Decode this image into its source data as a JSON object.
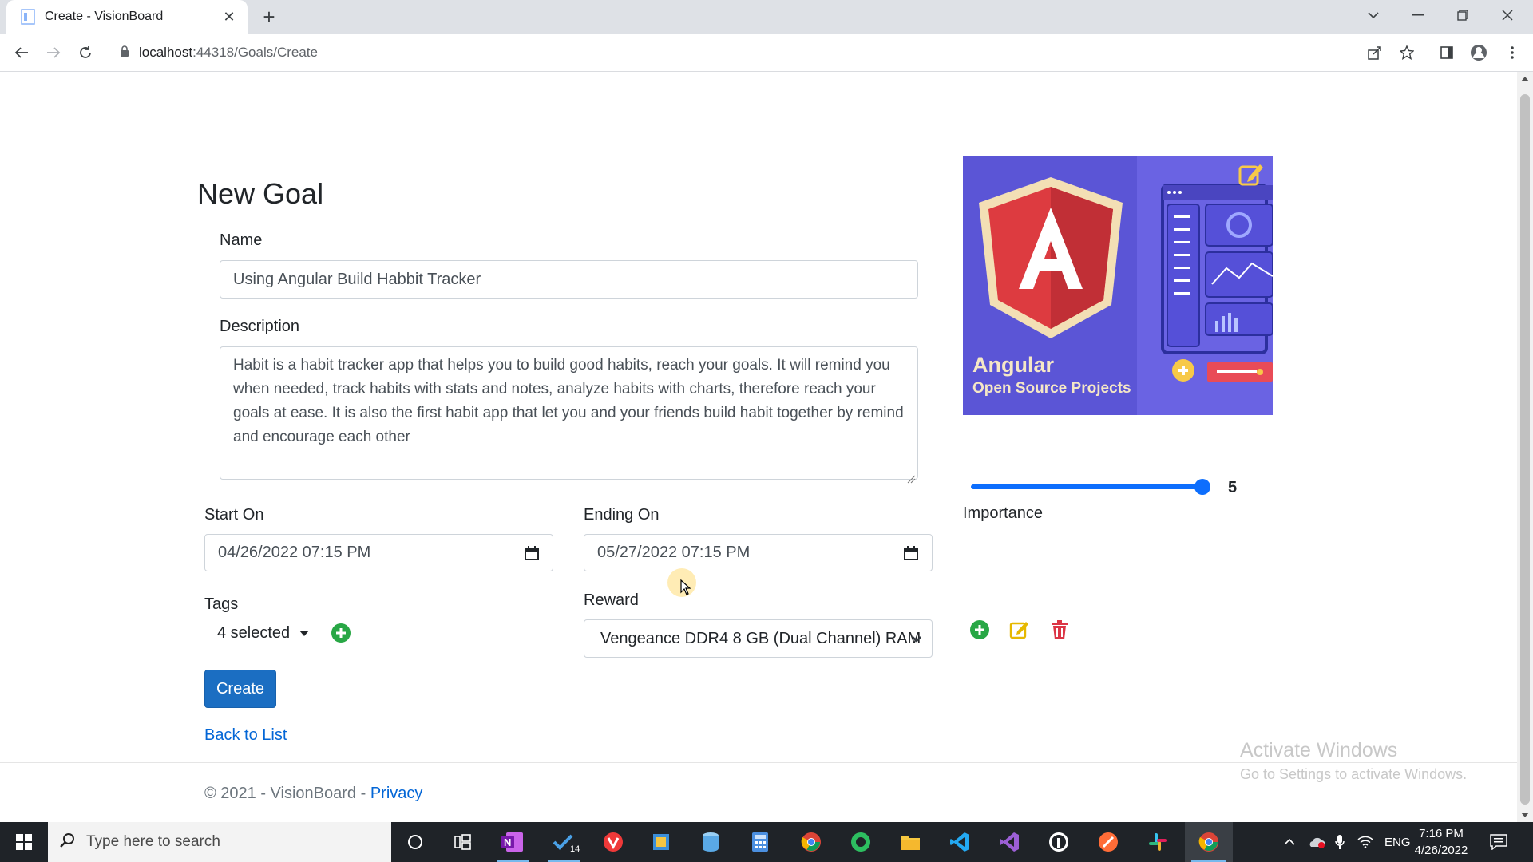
{
  "browser": {
    "tab_title": "Create - VisionBoard",
    "url_host": "localhost",
    "url_path": ":44318/Goals/Create"
  },
  "page": {
    "title": "New Goal",
    "name_label": "Name",
    "name_value": "Using Angular Build Habbit Tracker",
    "description_label": "Description",
    "description_value": "Habit is a habit tracker app that helps you to build good habits, reach your goals. It will remind you when needed, track habits with stats and notes, analyze habits with charts, therefore reach your goals at ease. It is also the first habit app that let you and your friends build habit together by remind and encourage each other",
    "start_label": "Start On",
    "start_value": "04/26/2022 07:15 PM",
    "end_label": "Ending On",
    "end_value": "05/27/2022 07:15 PM",
    "importance_label": "Importance",
    "importance_value": "5",
    "importance_level_fraction": 1.0,
    "tags_label": "Tags",
    "tags_value": "4 selected",
    "reward_label": "Reward",
    "reward_value": "Vengeance DDR4 8 GB (Dual Channel) RAM",
    "create_label": "Create",
    "back_label": "Back to List",
    "image_title": "Angular",
    "image_subtitle": "Open Source Projects"
  },
  "footer": {
    "copyright": "© 2021 - VisionBoard - ",
    "privacy": "Privacy"
  },
  "watermark": {
    "line1": "Activate Windows",
    "line2": "Go to Settings to activate Windows."
  },
  "taskbar": {
    "search_placeholder": "Type here to search",
    "language": "ENG",
    "time": "7:16 PM",
    "date": "4/26/2022",
    "todo_badge": "14"
  },
  "colors": {
    "primary": "#1b6ec2",
    "slider": "#0d6efd",
    "add_green": "#28a745",
    "edit_yellow": "#e6b800",
    "delete_red": "#dc3545"
  }
}
